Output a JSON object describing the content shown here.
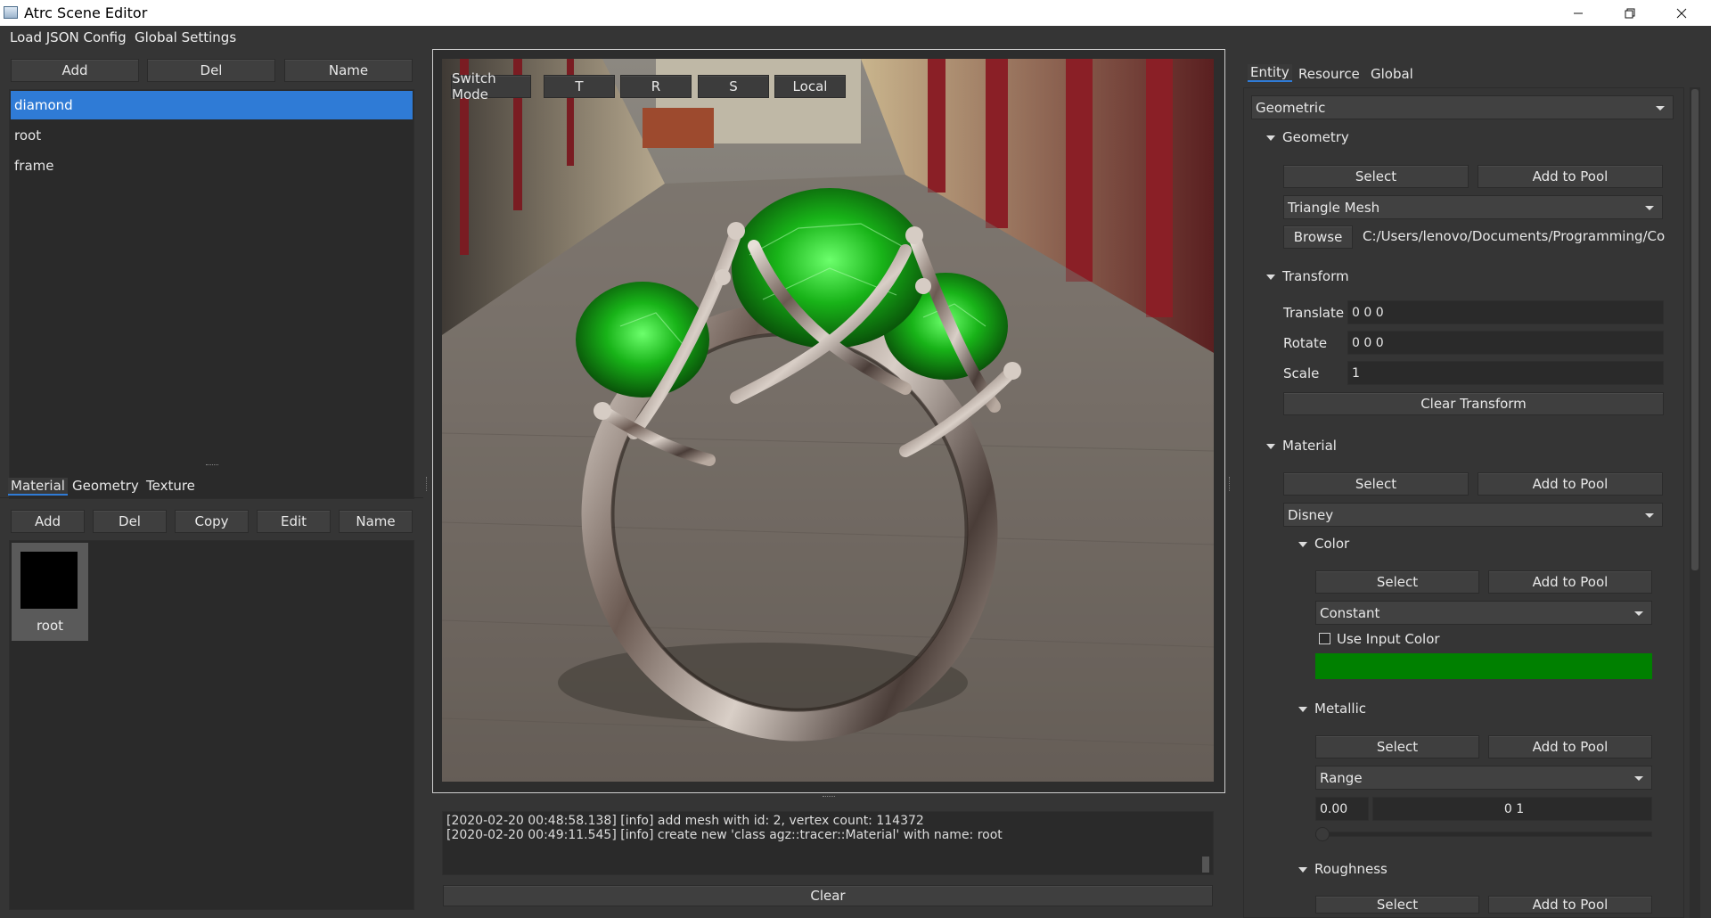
{
  "window": {
    "title": "Atrc Scene Editor"
  },
  "menubar": {
    "items": [
      "Load JSON Config",
      "Global Settings"
    ]
  },
  "entity_panel": {
    "buttons": [
      "Add",
      "Del",
      "Name"
    ],
    "items": [
      "diamond",
      "root",
      "frame"
    ]
  },
  "resource_panel": {
    "tabs": [
      "Material",
      "Geometry",
      "Texture"
    ],
    "buttons": [
      "Add",
      "Del",
      "Copy",
      "Edit",
      "Name"
    ],
    "thumbnail_label": "root"
  },
  "viewport": {
    "toolbar": [
      "Switch Mode",
      "T",
      "R",
      "S",
      "Local"
    ]
  },
  "console": {
    "lines": [
      "[2020-02-20 00:48:58.138] [info] add mesh with id: 2, vertex count: 114372",
      "[2020-02-20 00:49:11.545] [info] create new 'class agz::tracer::Material' with name: root"
    ],
    "clear_label": "Clear"
  },
  "properties": {
    "tabs": [
      "Entity",
      "Resource",
      "Global"
    ],
    "entity_type": "Geometric",
    "geometry": {
      "title": "Geometry",
      "select": "Select",
      "add_to_pool": "Add to Pool",
      "type": "Triangle Mesh",
      "browse": "Browse",
      "path": "C:/Users/lenovo/Documents/Programming/Co..."
    },
    "transform": {
      "title": "Transform",
      "translate_label": "Translate",
      "translate_value": "0 0 0",
      "rotate_label": "Rotate",
      "rotate_value": "0 0 0",
      "scale_label": "Scale",
      "scale_value": "1",
      "clear": "Clear Transform"
    },
    "material": {
      "title": "Material",
      "select": "Select",
      "add_to_pool": "Add to Pool",
      "type": "Disney",
      "color": {
        "title": "Color",
        "select": "Select",
        "add_to_pool": "Add to Pool",
        "type": "Constant",
        "use_input_label": "Use Input Color",
        "swatch_color": "#008000"
      },
      "metallic": {
        "title": "Metallic",
        "select": "Select",
        "add_to_pool": "Add to Pool",
        "type": "Range",
        "value": "0.00",
        "range": "0 1"
      },
      "roughness": {
        "title": "Roughness",
        "select": "Select",
        "add_to_pool": "Add to Pool"
      }
    }
  },
  "colors": {
    "selection": "#2f7bd6",
    "accent": "#2f7bd6"
  }
}
